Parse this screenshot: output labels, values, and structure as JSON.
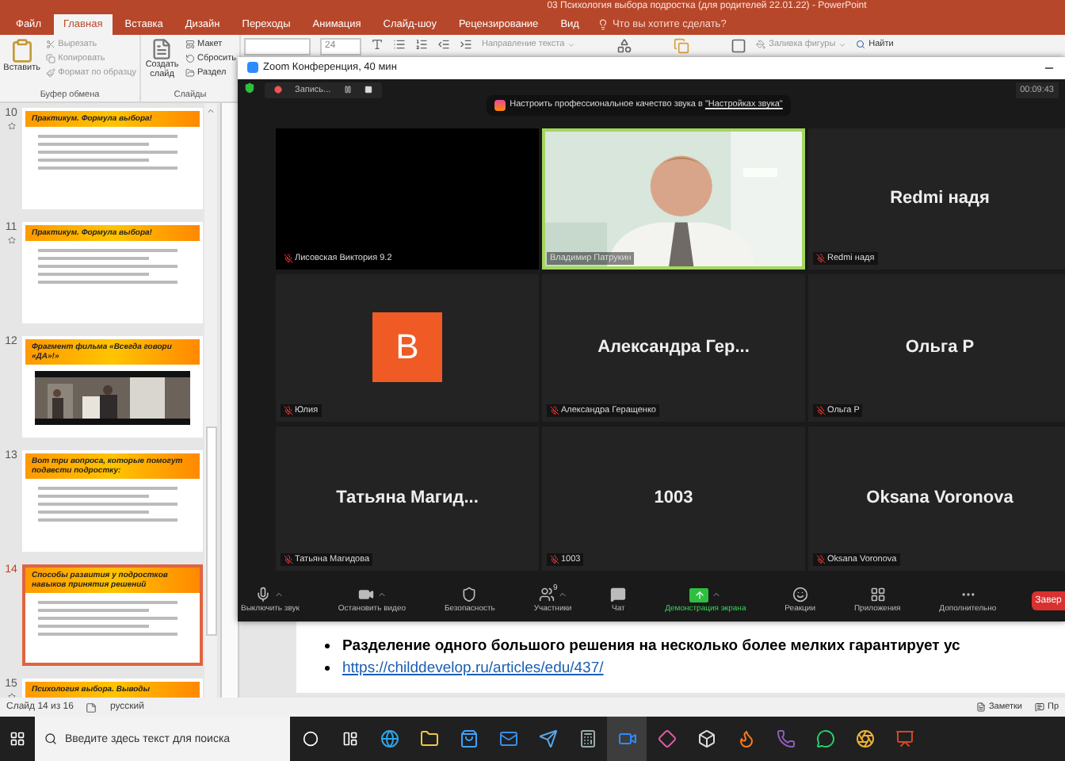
{
  "app": {
    "title": "03 Психология выбора подростка (для родителей 22.01.22) - PowerPoint"
  },
  "tabs": [
    {
      "label": "Файл",
      "selected": false
    },
    {
      "label": "Главная",
      "selected": true
    },
    {
      "label": "Вставка",
      "selected": false
    },
    {
      "label": "Дизайн",
      "selected": false
    },
    {
      "label": "Переходы",
      "selected": false
    },
    {
      "label": "Анимация",
      "selected": false
    },
    {
      "label": "Слайд-шоу",
      "selected": false
    },
    {
      "label": "Рецензирование",
      "selected": false
    },
    {
      "label": "Вид",
      "selected": false
    }
  ],
  "tell_me": {
    "placeholder": "Что вы хотите сделать?"
  },
  "ribbon": {
    "paste": "Вставить",
    "clipboard_items": [
      "Вырезать",
      "Копировать",
      "Формат по образцу"
    ],
    "clipboard_group": "Буфер обмена",
    "new_slide": "Создать слайд",
    "slide_items": [
      "Макет",
      "Сбросить",
      "Раздел"
    ],
    "slides_group": "Слайды",
    "font_size": "24",
    "text_direction": "Направление текста",
    "shape_fill": "Заливка фигуры",
    "find": "Найти"
  },
  "slides": [
    {
      "number": "10",
      "title": "Практикум. Формула выбора!",
      "kind": "text",
      "transition": true,
      "selected": false
    },
    {
      "number": "11",
      "title": "Практикум. Формула выбора!",
      "kind": "text",
      "transition": true,
      "selected": false
    },
    {
      "number": "12",
      "title": "Фрагмент фильма «Всегда говори «ДА»!»",
      "kind": "video",
      "transition": false,
      "selected": false
    },
    {
      "number": "13",
      "title": "Вот три вопроса, которые помогут подвести подростку:",
      "kind": "text",
      "transition": false,
      "selected": false
    },
    {
      "number": "14",
      "title": "Способы развития у подростков навыков принятия решений",
      "kind": "text",
      "transition": false,
      "selected": true
    },
    {
      "number": "15",
      "title": "Психология выбора. Выводы",
      "kind": "partial",
      "transition": true,
      "selected": false
    }
  ],
  "slide_content": {
    "bullets": [
      {
        "kind": "text",
        "text": "Разделение одного большого решения на несколько более мелких гарантирует ус"
      },
      {
        "kind": "link",
        "text": "https://childdevelop.ru/articles/edu/437/"
      }
    ]
  },
  "zoom": {
    "title": "Zoom Конференция, 40 мин",
    "recording": "Запись...",
    "notice": {
      "text": "Настроить профессиональное качество звука в ",
      "link": "\"Настройках звука\""
    },
    "timer": "00:09:43",
    "participants": [
      {
        "kind": "blank",
        "name": "Лисовская Виктория 9.2",
        "muted": true,
        "speaking": false
      },
      {
        "kind": "camera",
        "name": "Владимир Патрукин",
        "muted": false,
        "speaking": true
      },
      {
        "kind": "name",
        "display_name": "Redmi надя",
        "name": "Redmi надя",
        "muted": true,
        "speaking": false
      },
      {
        "kind": "avatar",
        "letter": "В",
        "color": "#f05a24",
        "name": "Юлия",
        "muted": true,
        "speaking": false
      },
      {
        "kind": "name",
        "display_name": "Александра  Гер...",
        "name": "Александра Геращенко",
        "muted": true,
        "speaking": false
      },
      {
        "kind": "name",
        "display_name": "Ольга Р",
        "name": "Ольга Р",
        "muted": true,
        "speaking": false
      },
      {
        "kind": "name",
        "display_name": "Татьяна  Магид...",
        "name": "Татьяна Магидова",
        "muted": true,
        "speaking": false
      },
      {
        "kind": "name",
        "display_name": "1003",
        "name": "1003",
        "muted": true,
        "speaking": false
      },
      {
        "kind": "name",
        "display_name": "Oksana Voronova",
        "name": "Oksana Voronova",
        "muted": true,
        "speaking": false
      }
    ],
    "toolbar": [
      {
        "label": "Выключить звук",
        "active": false,
        "caret": true
      },
      {
        "label": "Остановить видео",
        "active": false,
        "caret": true
      },
      {
        "label": "Безопасность",
        "active": false,
        "caret": false
      },
      {
        "label": "Участники",
        "active": false,
        "caret": true,
        "count": "9"
      },
      {
        "label": "Чат",
        "active": false,
        "caret": false
      },
      {
        "label": "Демонстрация экрана",
        "active": true,
        "caret": true
      },
      {
        "label": "Реакции",
        "active": false,
        "caret": false
      },
      {
        "label": "Приложения",
        "active": false,
        "caret": false
      },
      {
        "label": "Дополнительно",
        "active": false,
        "caret": false
      }
    ],
    "end_button": "Завер"
  },
  "status_bar": {
    "slide": "Слайд 14 из 16",
    "language": "русский",
    "notes": "Заметки",
    "comments": "Пр"
  },
  "taskbar": {
    "search": {
      "placeholder": "Введите здесь текст для поиска"
    },
    "apps": [
      {
        "active": false
      },
      {
        "active": false
      },
      {
        "active": false
      },
      {
        "active": false
      },
      {
        "active": false
      },
      {
        "active": false
      },
      {
        "active": true
      },
      {
        "active": false
      },
      {
        "active": false
      },
      {
        "active": false
      },
      {
        "active": false
      },
      {
        "active": false
      },
      {
        "active": false
      },
      {
        "active": false
      }
    ]
  }
}
